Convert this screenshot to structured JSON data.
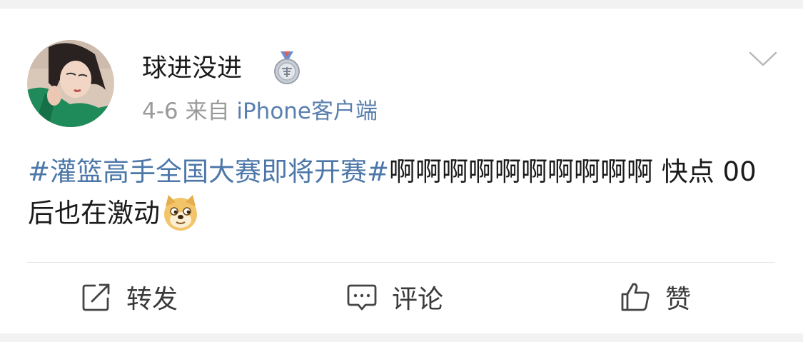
{
  "post": {
    "username": "球进没进",
    "date": "4-6",
    "source_prefix": "来自",
    "source": "iPhone客户端",
    "topic": "#灌篮高手全国大赛即将开赛#",
    "text": "啊啊啊啊啊啊啊啊啊啊 快点 00后也在激动"
  },
  "icons": {
    "badge": "medal-icon",
    "menu": "chevron-down-icon",
    "emoji": "doge-emoji-icon",
    "repost": "share-icon",
    "comment": "comment-icon",
    "like": "thumbs-up-icon"
  },
  "actions": {
    "repost_label": "转发",
    "comment_label": "评论",
    "like_label": "赞"
  },
  "colors": {
    "topic_link": "#4c77a8",
    "source_link": "#5a7fae",
    "meta_gray": "#9a9a9a",
    "background": "#f2f2f2"
  }
}
